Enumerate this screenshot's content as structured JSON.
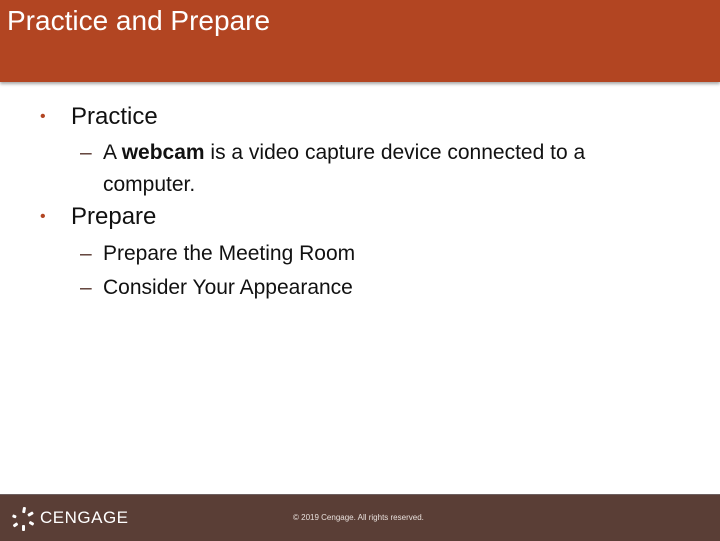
{
  "slide": {
    "title": "Practice and Prepare",
    "colors": {
      "header": "#b24522",
      "footer": "#5a3e36",
      "bullet": "#b24522",
      "text": "#111111"
    },
    "bullets": [
      {
        "label": "Practice",
        "sub": [
          {
            "prefix": "A ",
            "bold": "webcam",
            "suffix": " is a video capture device connected to a computer."
          }
        ]
      },
      {
        "label": "Prepare",
        "sub": [
          {
            "text": "Prepare the Meeting Room"
          },
          {
            "text": "Consider Your Appearance"
          }
        ]
      }
    ],
    "bullet_glyph": "•",
    "dash_glyph": "–"
  },
  "footer": {
    "logo_icon": "cengage-pinwheel-icon",
    "logo_text": "CENGAGE",
    "copyright": "© 2019 Cengage. All rights reserved."
  }
}
